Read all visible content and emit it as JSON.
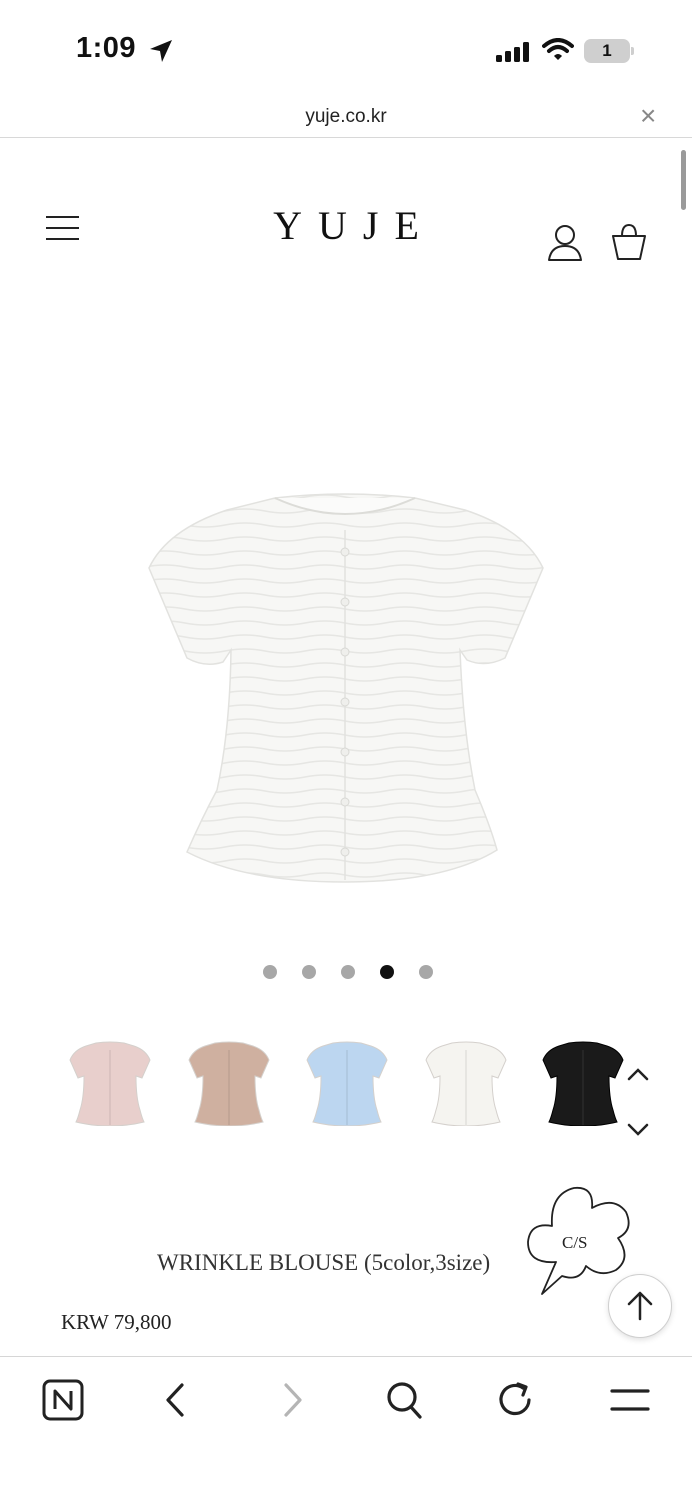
{
  "status_bar": {
    "time": "1:09",
    "battery": "1"
  },
  "browser": {
    "url": "yuje.co.kr",
    "close_glyph": "×"
  },
  "site": {
    "logo": "YUJE",
    "icons": [
      "menu-icon",
      "account-icon",
      "shopping-bag-icon"
    ]
  },
  "gallery": {
    "dot_count": 5,
    "active_index": 3,
    "swatches": [
      {
        "name": "pink",
        "color": "#e8cfcc"
      },
      {
        "name": "beige",
        "color": "#cfb0a0"
      },
      {
        "name": "blue",
        "color": "#bcd6f0"
      },
      {
        "name": "ivory",
        "color": "#f5f4f0"
      },
      {
        "name": "black",
        "color": "#1a1a1a"
      }
    ]
  },
  "product": {
    "title": "WRINKLE BLOUSE (5color,3size)",
    "price": "KRW 79,800",
    "cs_label": "C/S"
  },
  "toolbar": {
    "items": [
      "naver-icon",
      "back-icon",
      "forward-icon",
      "search-icon",
      "reload-icon",
      "menu-icon"
    ]
  }
}
